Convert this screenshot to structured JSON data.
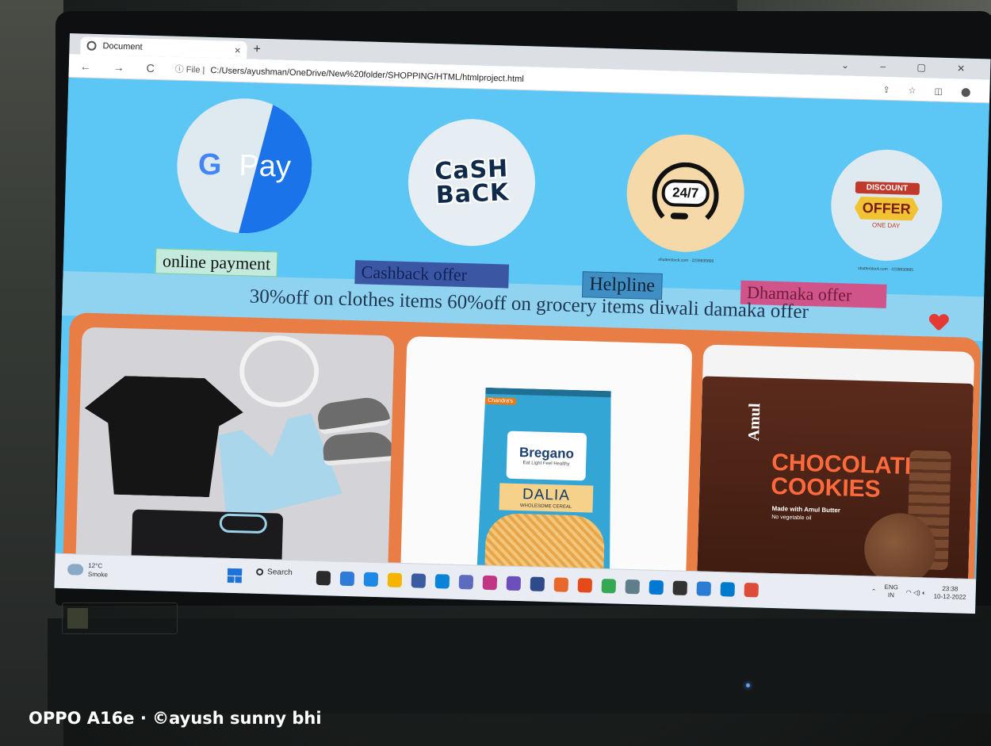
{
  "browser": {
    "tab_title": "Document",
    "tab_close": "×",
    "new_tab": "+",
    "nav_buttons": "← → C",
    "window_controls": "⌄ – ▢ ✕",
    "address_prefix": "ⓘ File |",
    "address": "C:/Users/ayushman/OneDrive/New%20folder/SHOPPING/HTML/htmlproject.html",
    "right_icons": "⇪ ☆ ◫ ⬤"
  },
  "page": {
    "icons": [
      {
        "name": "gpay-logo",
        "g": "G",
        "text": "Pay"
      },
      {
        "name": "cashback-logo",
        "line1": "CaSH",
        "line2": "BaCK"
      },
      {
        "name": "helpline-logo",
        "text": "24/7"
      },
      {
        "name": "discount-logo",
        "line1": "DISCOUNT",
        "line2": "OFFER",
        "line3": "ONE DAY"
      }
    ],
    "watermark": "shutterstock.com · 2239930895",
    "labels": {
      "online_payment": "online payment",
      "cashback_offer": "Cashback offer",
      "helpline": "Helpline",
      "dhamaka_offer": "Dhamaka offer"
    },
    "marquee": "30%off on clothes items 60%off on grocery items diwali damaka offer",
    "products": {
      "dalia": {
        "top": "Chandra's",
        "brand": "Bregano",
        "tagline": "Eat Light Feel Healthy",
        "name": "DALIA",
        "sub": "WHOLESOME CEREAL"
      },
      "cookies": {
        "brand": "Amul",
        "line1": "CHOCOLATE",
        "line2": "COOKIES",
        "made": "Made with Amul Butter",
        "noveg": "No vegetable oil"
      }
    }
  },
  "taskbar": {
    "temp": "12°C",
    "weather": "Smoke",
    "search": "Search",
    "lang1": "ENG",
    "lang2": "IN",
    "time": "23:38",
    "date": "10-12-2022",
    "app_colors": [
      "#2b2b2b",
      "#2f7cd8",
      "#1e88e5",
      "#f4b400",
      "#3a5ba0",
      "#0a84d6",
      "#5c6bc0",
      "#c13584",
      "#6b4fbb",
      "#2d4a8a",
      "#e8672a",
      "#e64a19",
      "#34a853",
      "#607d8b",
      "#0078d4",
      "#333333",
      "#2b7cd3",
      "#007acc",
      "#dd4b39"
    ]
  },
  "footer": "OPPO A16e · ©ayush sunny bhi"
}
